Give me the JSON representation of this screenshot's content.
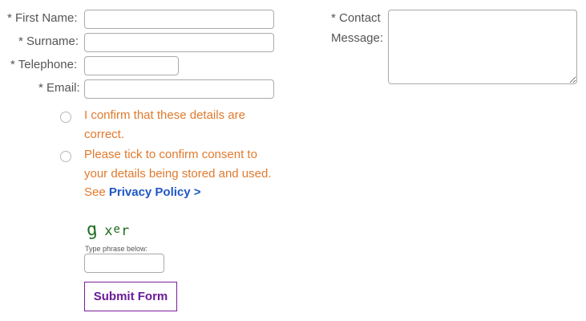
{
  "form": {
    "first_name_label": "* First Name:",
    "surname_label": "* Surname:",
    "telephone_label": "* Telephone:",
    "email_label": "* Email:",
    "contact_label_line1": "* Contact",
    "contact_label_line2": "Message:",
    "first_name_value": "",
    "surname_value": "",
    "telephone_value": "",
    "email_value": "",
    "message_value": ""
  },
  "consent": {
    "confirm_details_text": "I confirm that these details are correct.",
    "store_consent_text": "Please tick to confirm consent to your details being stored and used. See",
    "privacy_link_text": "Privacy Policy >",
    "confirm_details_checked": false,
    "store_consent_checked": false
  },
  "captcha": {
    "chars": [
      "g",
      "x",
      "e",
      "r"
    ],
    "hint": "Type phrase below:",
    "value": ""
  },
  "submit_label": "Submit Form",
  "colors": {
    "label": "#555555",
    "consent_text": "#e07a2e",
    "link": "#1f57c3",
    "captcha": "#1d6d1d",
    "submit": "#6a1b9a",
    "input_border": "#aaaaaa"
  }
}
